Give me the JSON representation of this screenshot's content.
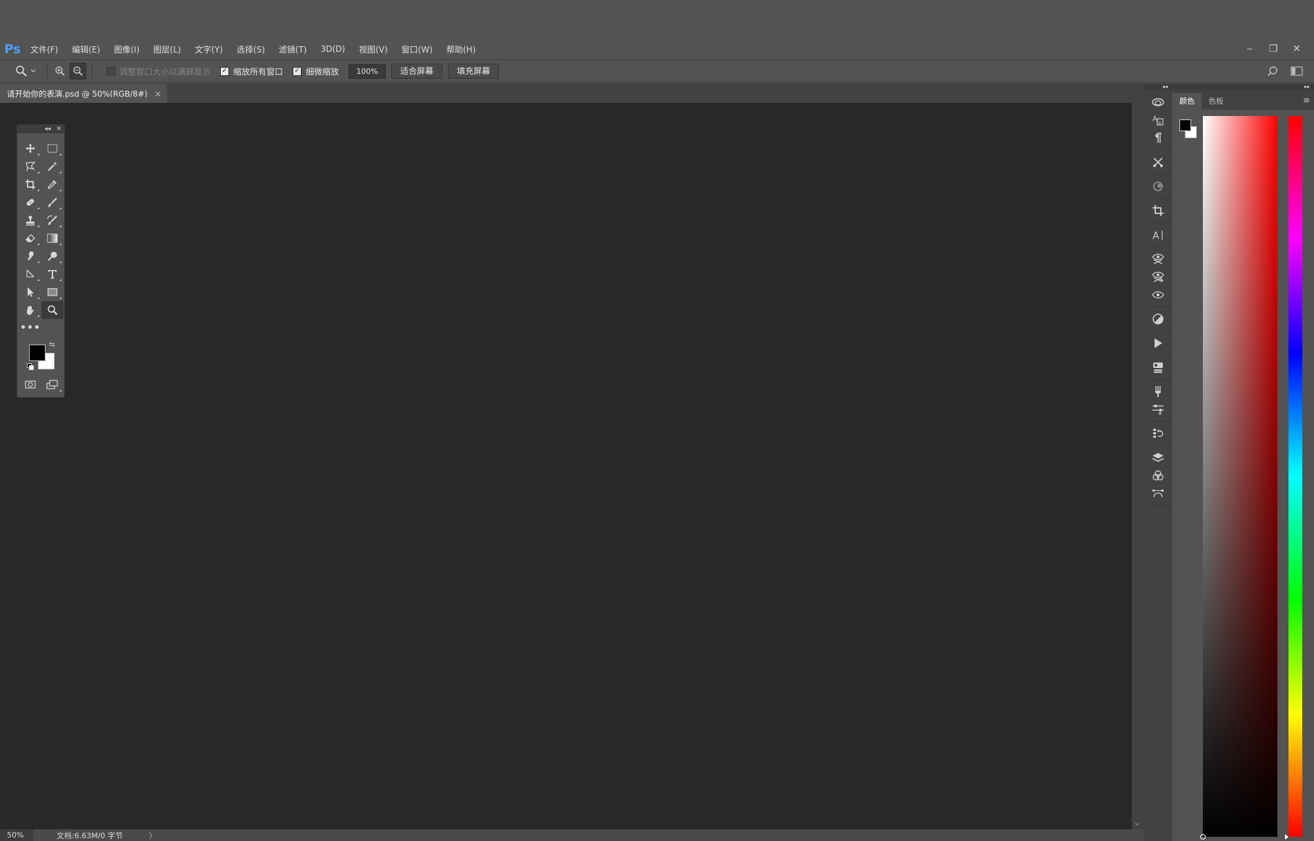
{
  "app": {
    "logo": "Ps"
  },
  "menu": {
    "items": [
      "文件(F)",
      "编辑(E)",
      "图像(I)",
      "图层(L)",
      "文字(Y)",
      "选择(S)",
      "滤镜(T)",
      "3D(D)",
      "视图(V)",
      "窗口(W)",
      "帮助(H)"
    ]
  },
  "window_controls": {
    "minimize": "‒",
    "restore": "❐",
    "close": "✕"
  },
  "options": {
    "resize_windows_label": "调整窗口大小以满屏显示",
    "resize_windows_checked": false,
    "zoom_all_windows_label": "缩放所有窗口",
    "zoom_all_windows_checked": true,
    "scrubby_zoom_label": "细微缩放",
    "scrubby_zoom_checked": true,
    "zoom_value": "100%",
    "fit_screen_label": "适合屏幕",
    "fill_screen_label": "填充屏幕"
  },
  "document": {
    "tab_title": "请开始你的表演.psd @ 50%(RGB/8#)",
    "tab_close": "×"
  },
  "status": {
    "zoom": "50%",
    "doc_info": "文档:6.63M/0 字节",
    "arrow": "〉"
  },
  "toolbox": {
    "tools": [
      "move-tool",
      "marquee-tool",
      "lasso-tool",
      "magic-wand-tool",
      "crop-tool",
      "eyedropper-tool",
      "healing-brush-tool",
      "brush-tool",
      "clone-stamp-tool",
      "history-brush-tool",
      "eraser-tool",
      "gradient-tool",
      "smudge-tool",
      "dodge-tool",
      "pen-tool",
      "type-tool",
      "path-selection-tool",
      "rectangle-tool",
      "hand-tool",
      "zoom-tool"
    ],
    "active_tool": "zoom-tool",
    "more_label": "•••",
    "foreground_color": "#000000",
    "background_color": "#ffffff"
  },
  "side_icons": [
    "libraries-icon",
    "character-style-icon",
    "paragraph-icon",
    "tool-presets-icon",
    "clone-source-icon",
    "crop-icon",
    "character-icon",
    "puppet-warp-icon",
    "liquify-icon",
    "eye-icon",
    "adjustments-icon",
    "actions-icon",
    "properties-icon",
    "brush-settings-icon",
    "sliders-icon",
    "history-icon",
    "layers-icon",
    "channels-icon",
    "paths-icon"
  ],
  "color_panel": {
    "tabs": [
      "颜色",
      "色板"
    ],
    "active_tab": "颜色",
    "menu_icon": "≡",
    "hue_color": "#ff0000",
    "foreground": "#000000",
    "background": "#ffffff"
  }
}
